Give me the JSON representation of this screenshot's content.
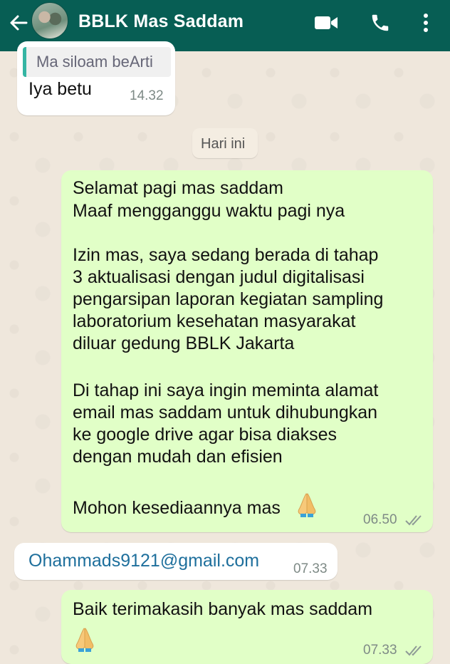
{
  "header": {
    "contact_name": "BBLK Mas Saddam",
    "colors": {
      "bar": "#075e54",
      "outgoing": "#e1ffc7",
      "incoming": "#ffffff",
      "link": "#1e6f9c"
    }
  },
  "icons": [
    "back-arrow-icon",
    "video-call-icon",
    "phone-icon",
    "more-options-icon",
    "double-check-icon",
    "folded-hands-emoji"
  ],
  "messages": {
    "m1": {
      "quote": "Ma siloam beArti",
      "text": "Iya betu",
      "time": "14.32"
    },
    "date_divider": "Hari ini",
    "m2": {
      "line1": "Selamat pagi mas saddam",
      "line2": "Maaf mengganggu waktu pagi nya",
      "para2_line1": "Izin mas, saya sedang berada di tahap",
      "para2_line2": "3 aktualisasi dengan judul digitalisasi",
      "para2_line3": "pengarsipan laporan kegiatan sampling",
      "para2_line4": "laboratorium kesehatan masyarakat",
      "para2_line5": "diluar gedung BBLK Jakarta",
      "para3_line1": "Di tahap ini saya ingin meminta alamat",
      "para3_line2": "email mas saddam untuk dihubungkan",
      "para3_line3": "ke google drive agar bisa diakses",
      "para3_line4": "dengan mudah dan efisien",
      "closing": "Mohon kesediaannya mas",
      "time": "06.50"
    },
    "m3": {
      "email": "Ohammads9121@gmail.com",
      "time": "07.33"
    },
    "m4": {
      "text": "Baik terimakasih banyak mas saddam",
      "time": "07.33"
    }
  }
}
